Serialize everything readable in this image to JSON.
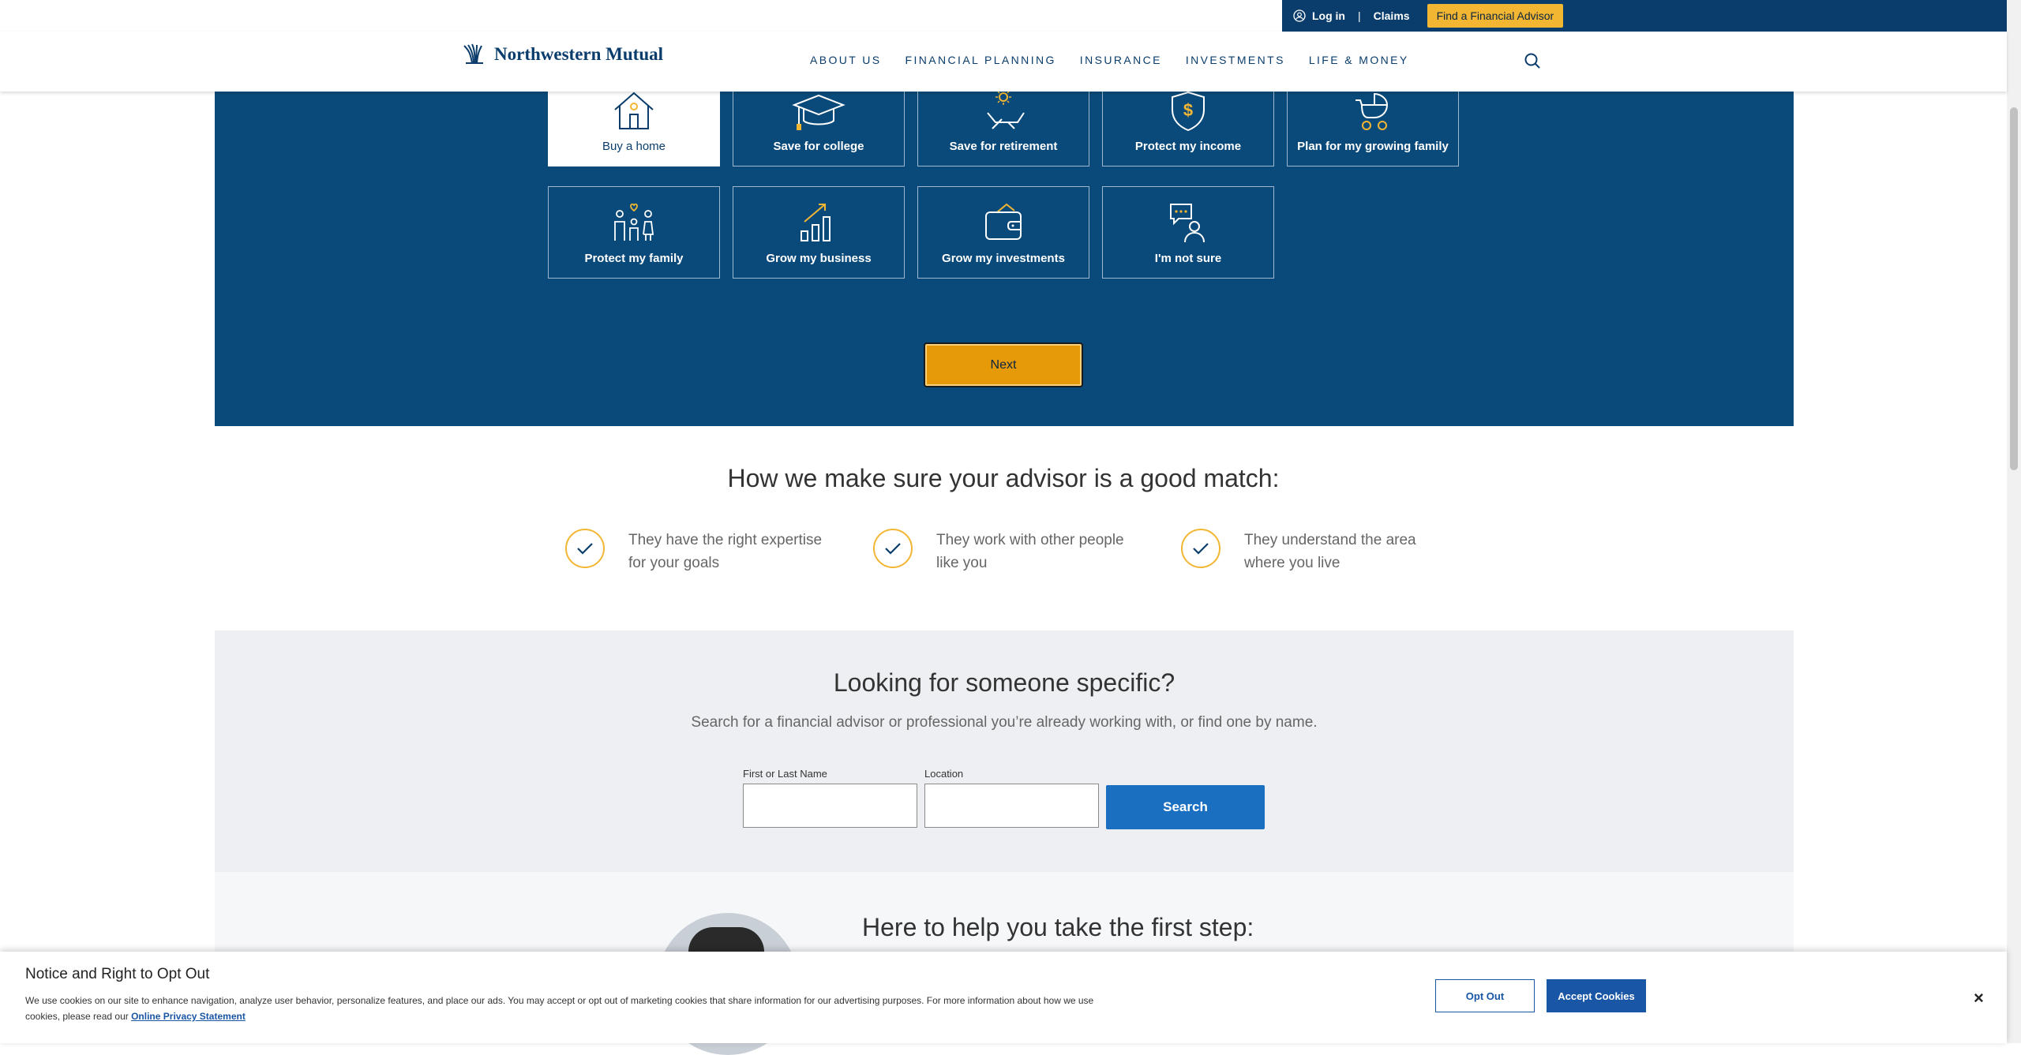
{
  "utility": {
    "login": "Log in",
    "separator": "|",
    "claims": "Claims",
    "advisor_button": "Find a Financial Advisor"
  },
  "header": {
    "logo_text": "Northwestern Mutual",
    "nav": [
      "ABOUT US",
      "FINANCIAL PLANNING",
      "INSURANCE",
      "INVESTMENTS",
      "LIFE & MONEY"
    ]
  },
  "goals": {
    "tiles": [
      {
        "label": "Buy a home",
        "icon": "house-icon",
        "selected": true
      },
      {
        "label": "Save for college",
        "icon": "graduation-cap-icon",
        "selected": false
      },
      {
        "label": "Save for retirement",
        "icon": "beach-chair-icon",
        "selected": false
      },
      {
        "label": "Protect my income",
        "icon": "shield-dollar-icon",
        "selected": false
      },
      {
        "label": "Plan for my growing family",
        "icon": "stroller-icon",
        "selected": false
      },
      {
        "label": "Protect my family",
        "icon": "family-icon",
        "selected": false
      },
      {
        "label": "Grow my business",
        "icon": "bar-chart-icon",
        "selected": false
      },
      {
        "label": "Grow my investments",
        "icon": "wallet-icon",
        "selected": false
      },
      {
        "label": "I'm not sure",
        "icon": "person-chat-icon",
        "selected": false
      }
    ],
    "next_button": "Next"
  },
  "match": {
    "title": "How we make sure your advisor is a good match:",
    "items": [
      {
        "line1": "They have the right expertise",
        "line2": "for your goals"
      },
      {
        "line1": "They work with other people",
        "line2": "like you"
      },
      {
        "line1": "They understand the area",
        "line2": "where you live"
      }
    ]
  },
  "looking": {
    "title": "Looking for someone specific?",
    "subtitle": "Search for a financial advisor or professional you’re already working with, or find one by name.",
    "name_label": "First or Last Name",
    "location_label": "Location",
    "search_button": "Search"
  },
  "help": {
    "title": "Here to help you take the first step:"
  },
  "cookie": {
    "title": "Notice and Right to Opt Out",
    "body": "We use cookies on our site to enhance navigation, analyze user behavior, personalize features, and place our ads. You may accept or opt out of marketing cookies that share information for our advertising purposes. For more information about how we use cookies, please read our ",
    "link": "Online Privacy Statement",
    "opt_out": "Opt Out",
    "accept": "Accept Cookies",
    "close": "×"
  },
  "colors": {
    "navy": "#0a3d6b",
    "hero_blue": "#0a4a7a",
    "gold": "#f2b632",
    "next_orange": "#e69a07",
    "search_blue": "#1a6fc0"
  }
}
